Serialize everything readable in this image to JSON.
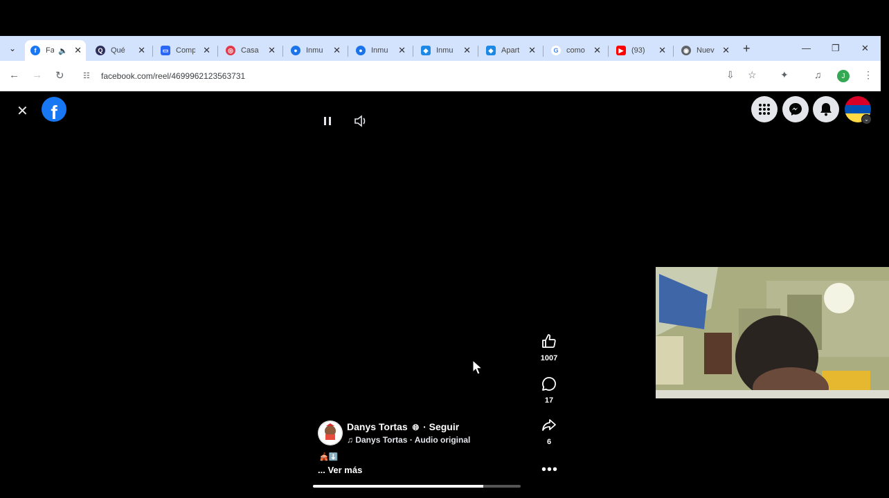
{
  "browser": {
    "tabs": [
      {
        "title": "Fa",
        "favicon": "facebook-icon",
        "color": "#1877f2",
        "active": true,
        "muted_icon": true
      },
      {
        "title": "Qué",
        "favicon": "q-icon",
        "color": "#2d2f5a"
      },
      {
        "title": "Comp",
        "favicon": "card-icon",
        "color": "#2a67f6"
      },
      {
        "title": "Casa",
        "favicon": "target-icon",
        "color": "#e2394b"
      },
      {
        "title": "Inmu",
        "favicon": "pin-icon",
        "color": "#1a73e8"
      },
      {
        "title": "Inmu",
        "favicon": "pin-icon",
        "color": "#1a73e8"
      },
      {
        "title": "Inmu",
        "favicon": "map-icon",
        "color": "#1e88e5"
      },
      {
        "title": "Apart",
        "favicon": "map-icon",
        "color": "#1e88e5"
      },
      {
        "title": "como",
        "favicon": "google-icon",
        "color": "#4285f4"
      },
      {
        "title": "(93)",
        "favicon": "youtube-icon",
        "color": "#ff0000"
      },
      {
        "title": "Nuev",
        "favicon": "chrome-icon",
        "color": "#5f6368"
      }
    ],
    "url": "facebook.com/reel/4699962123563731",
    "profile_initial": "J"
  },
  "reel": {
    "likes": "1007",
    "comments": "17",
    "shares": "6",
    "author": "Danys Tortas",
    "follow": "· Seguir",
    "audio": "Danys Tortas · Audio original",
    "emojis": "🎪⬇️",
    "see_more": "... Ver más",
    "progress": 0.82
  },
  "colors": {
    "facebook_blue": "#1877f2",
    "chrome_tabbar": "#d3e3fd",
    "page_bg": "#000000"
  }
}
